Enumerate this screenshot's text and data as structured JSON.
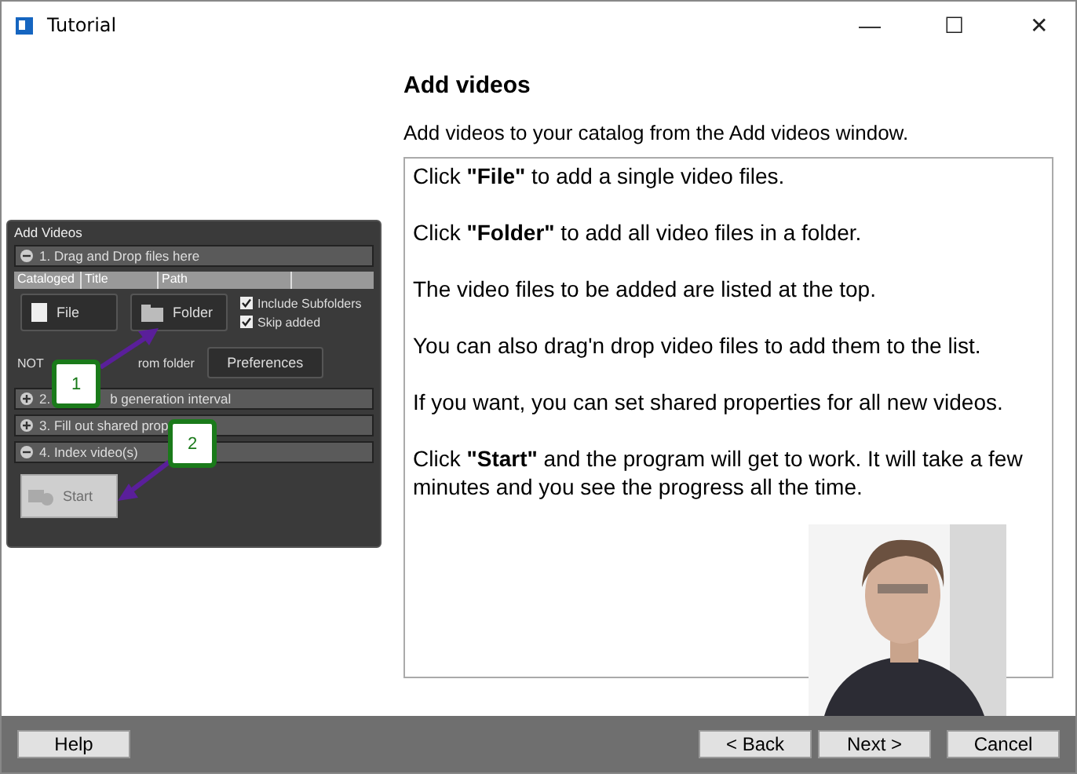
{
  "window": {
    "title": "Tutorial",
    "controls": [
      "—",
      "☐",
      "✕"
    ]
  },
  "inset": {
    "title": "Add Videos",
    "sections": [
      {
        "label": "1. Drag and Drop files here",
        "expanded": true
      },
      {
        "label": "2.",
        "tail": "b generation interval",
        "expanded": false
      },
      {
        "label": "3. Fill out shared prop",
        "expanded": false
      },
      {
        "label": "4. Index video(s)",
        "expanded": true
      }
    ],
    "columns": [
      "Cataloged",
      "Title",
      "Path"
    ],
    "file_button": "File",
    "folder_button": "Folder",
    "options": [
      {
        "label": "Include Subfolders",
        "checked": true
      },
      {
        "label": "Skip added",
        "checked": true
      }
    ],
    "note_start": "NOT",
    "note_end": "rom folder",
    "preferences_button": "Preferences",
    "start_button": {
      "label": "Start",
      "disabled": true
    },
    "callouts": [
      "1",
      "2"
    ]
  },
  "heading": "Add videos",
  "intro": "Add videos to your catalog from the Add videos window.",
  "paragraphs": [
    "Click **\"File\"** to add a single video files.",
    "Click **\"Folder\"** to add all video files in a folder.",
    "The video files to be added are listed at the top.",
    "You can also drag'n drop video files to add them to the list.",
    "If you want, you can set shared properties for all new videos.",
    "Click **\"Start\"** and the program will get to work. It will take a few minutes and you see the progress all the time."
  ],
  "footer": {
    "help": "Help",
    "back": "< Back",
    "next": "Next >",
    "cancel": "Cancel"
  }
}
